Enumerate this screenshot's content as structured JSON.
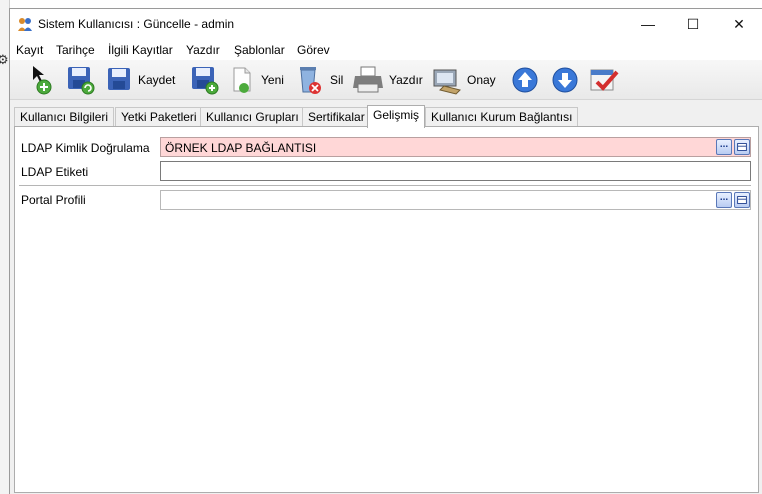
{
  "window": {
    "title": "Sistem Kullanıcısı : Güncelle - admin",
    "minimize_glyph": "—",
    "maximize_glyph": "☐",
    "close_glyph": "✕"
  },
  "menu": [
    "Kayıt",
    "Tarihçe",
    "İlgili Kayıtlar",
    "Yazdır",
    "Şablonlar",
    "Görev"
  ],
  "toolbar": {
    "save_label": "Kaydet",
    "new_label": "Yeni",
    "delete_label": "Sil",
    "print_label": "Yazdır",
    "approve_label": "Onay"
  },
  "tabs": [
    "Kullanıcı Bilgileri",
    "Yetki Paketleri",
    "Kullanıcı Grupları",
    "Sertifikalar",
    "Gelişmiş",
    "Kullanıcı Kurum Bağlantısı"
  ],
  "active_tab": "Gelişmiş",
  "form": {
    "ldap_auth_label": "LDAP Kimlik Doğrulama",
    "ldap_auth_value": "ÖRNEK LDAP BAĞLANTISI",
    "ldap_tag_label": "LDAP Etiketi",
    "ldap_tag_value": "",
    "portal_profile_label": "Portal Profili",
    "portal_profile_value": "",
    "lookup_glyph": "..."
  },
  "colors": {
    "required_field_bg": "#ffd7d7",
    "accent_blue": "#3a78d8"
  }
}
